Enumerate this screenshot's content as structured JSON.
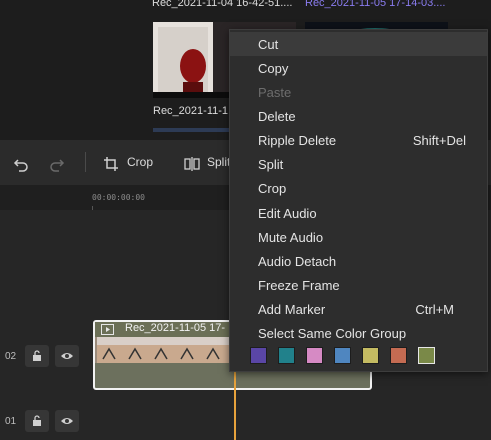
{
  "media": {
    "clips": [
      {
        "name": "Rec_2021-11-04 16-42-51...."
      },
      {
        "name": "Rec_2021-11-05 17-14-03...."
      },
      {
        "name": "Rec_2021-11-1"
      }
    ]
  },
  "toolbar": {
    "crop_label": "Crop",
    "split_label": "Split"
  },
  "ruler": {
    "timecode": "00:00:00:00"
  },
  "tracks": [
    {
      "number": "02"
    },
    {
      "number": "01"
    }
  ],
  "timeline_clip": {
    "name": "Rec_2021-11-05 17-"
  },
  "context_menu": {
    "items": [
      {
        "label": "Cut",
        "shortcut": ""
      },
      {
        "label": "Copy",
        "shortcut": ""
      },
      {
        "label": "Paste",
        "shortcut": ""
      },
      {
        "label": "Delete",
        "shortcut": ""
      },
      {
        "label": "Ripple Delete",
        "shortcut": "Shift+Del"
      },
      {
        "label": "Split",
        "shortcut": ""
      },
      {
        "label": "Crop",
        "shortcut": ""
      },
      {
        "label": "Edit Audio",
        "shortcut": ""
      },
      {
        "label": "Mute Audio",
        "shortcut": ""
      },
      {
        "label": "Audio Detach",
        "shortcut": ""
      },
      {
        "label": "Freeze Frame",
        "shortcut": ""
      },
      {
        "label": "Add Marker",
        "shortcut": "Ctrl+M"
      },
      {
        "label": "Select Same Color Group",
        "shortcut": ""
      }
    ],
    "color_swatches": [
      "#5a46a6",
      "#21818b",
      "#d68ac4",
      "#4f86c0",
      "#c4bb62",
      "#c46b52",
      "#7a8948"
    ],
    "selected_swatch_index": 6,
    "hovered_item_index": 0,
    "disabled_item_index": 2
  },
  "colors": {
    "playhead": "#e6a23c",
    "clip_body": "#6c705d",
    "clip_header": "#6b6f56"
  }
}
